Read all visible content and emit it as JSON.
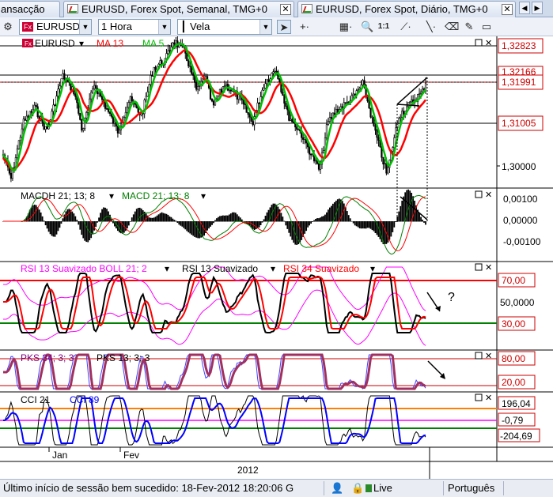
{
  "tabs": [
    {
      "label": "ansacção",
      "has_icon": false
    },
    {
      "label": "EURUSD, Forex Spot, Semanal, TMG+0",
      "has_icon": true
    },
    {
      "label": "EURUSD, Forex Spot, Diário, TMG+0",
      "has_icon": true
    }
  ],
  "toolbar": {
    "symbol": "EURUSD",
    "timeframe": "1 Hora",
    "chart_type": "Vela",
    "icons": [
      "cursor-icon",
      "crosshair-icon",
      "grid-icon",
      "zoom-in-icon",
      "zoom-1-1-icon",
      "line-icon",
      "eraser-icon",
      "pen-icon",
      "box-icon"
    ],
    "zoom_label": "1:1"
  },
  "main_panel": {
    "symbol_label": "EURUSD",
    "ma13_label": "MA 13",
    "ma5_label": "MA 5",
    "price_labels": [
      "1,32823",
      "1,32166",
      "1,31991",
      "1,31005",
      "1,30000"
    ],
    "colors": {
      "ma13": "#ff0000",
      "ma5": "#00c000",
      "candles": "#000000"
    }
  },
  "macd_panel": {
    "histogram_label": "MACDH 21; 13; 8",
    "macd_label": "MACD 21; 13; 8",
    "axis_labels": [
      "0,00100",
      "0,00000",
      "-0,00100"
    ]
  },
  "rsi_panel": {
    "boll_label": "RSI 13 Suavizado BOLL 21; 2",
    "rsi13_label": "RSI 13 Suavizado",
    "rsi34_label": "RSI 34 Suavizado",
    "axis_labels": [
      "70,00",
      "50,0000",
      "30,00"
    ],
    "annotation": "?"
  },
  "pks_panel": {
    "pks34_label": "PKS 34; 3; 3",
    "pks13_label": "PKS 13; 3; 3",
    "axis_labels": [
      "80,00",
      "20,00"
    ]
  },
  "cci_panel": {
    "cci21_label": "CCI 21",
    "cci89_label": "CCI 89",
    "axis_labels": [
      "196,04",
      "-0,79",
      "-204,69"
    ]
  },
  "time_axis": {
    "month_labels": [
      "Jan",
      "Fev"
    ],
    "year_label": "2012"
  },
  "status": {
    "message": "Último início de sessão bem sucedido: 18-Fev-2012 18:20:06 G",
    "connection": "Live",
    "language": "Português"
  }
}
